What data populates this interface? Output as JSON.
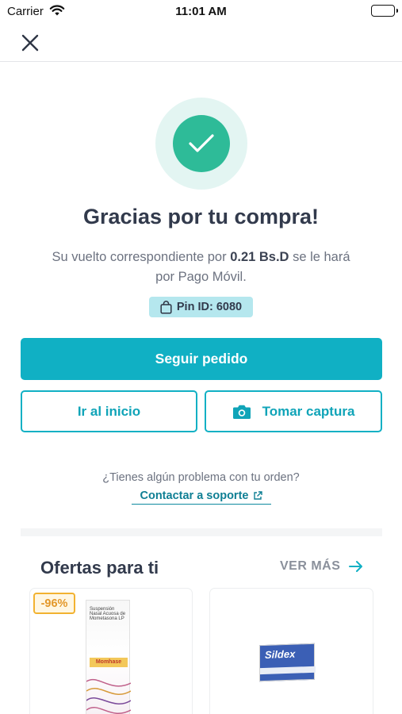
{
  "status_bar": {
    "carrier": "Carrier",
    "time": "11:01 AM"
  },
  "header": {
    "close_icon": "close-icon"
  },
  "confirmation": {
    "icon": "check-icon",
    "title": "Gracias por tu compra!",
    "subtitle_prefix": "Su vuelto correspondiente por ",
    "amount": "0.21 Bs.D",
    "subtitle_suffix": " se le hará por Pago Móvil.",
    "pin_icon": "shopping-bag-icon",
    "pin_label": "Pin ID: 6080"
  },
  "actions": {
    "primary_label": "Seguir pedido",
    "home_label": "Ir al inicio",
    "capture_icon": "camera-icon",
    "capture_label": "Tomar captura"
  },
  "support": {
    "question": "¿Tienes algún problema con tu orden?",
    "link_label": "Contactar a soporte",
    "link_icon": "external-link-icon"
  },
  "offers": {
    "title": "Ofertas para ti",
    "see_more_label": "VER MÁS",
    "see_more_icon": "arrow-right-icon",
    "products": [
      {
        "discount": "-96%",
        "box_text": "Suspensión Nasal Acuosa de Mometasona LP",
        "box_brand": "Momhase"
      },
      {
        "box_brand": "Sildex"
      }
    ]
  },
  "colors": {
    "primary": "#10b0c4",
    "success": "#2ebb98",
    "success_halo": "#e3f5f2",
    "badge_bg": "#b5e7ee",
    "discount": "#f2b230"
  }
}
